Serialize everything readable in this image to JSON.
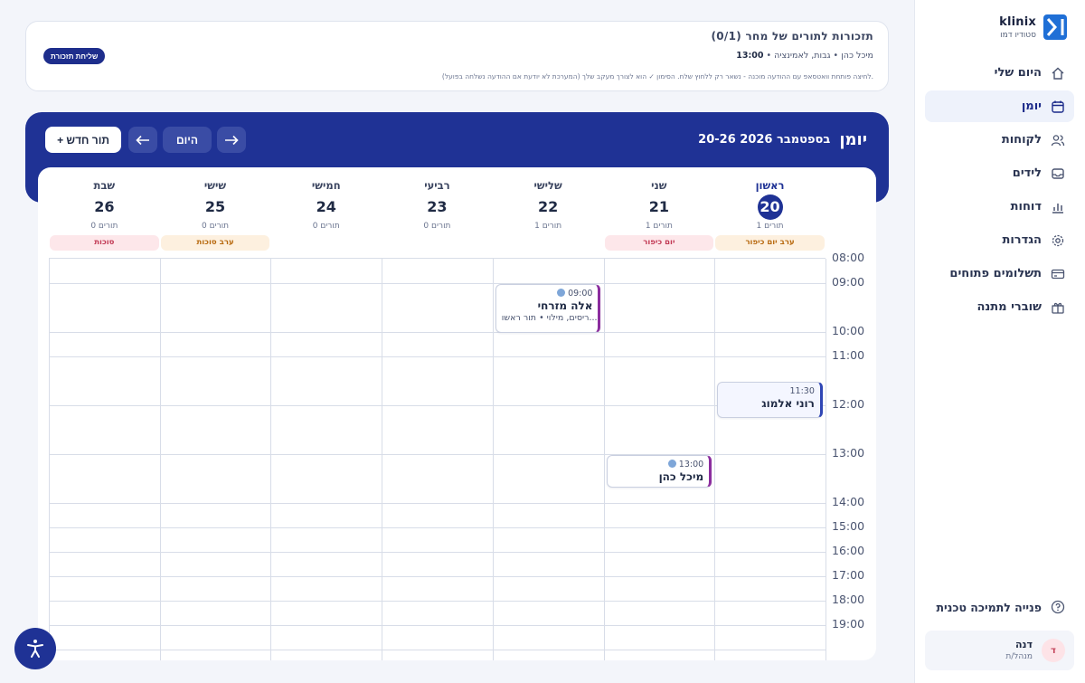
{
  "brand": {
    "name": "klinix",
    "subtitle": "סטודיו דמו"
  },
  "sidebar": {
    "items": [
      {
        "label": "היום שלי",
        "icon": "home-icon",
        "active": false
      },
      {
        "label": "יומן",
        "icon": "calendar-icon",
        "active": true
      },
      {
        "label": "לקוחות",
        "icon": "users-icon",
        "active": false
      },
      {
        "label": "לידים",
        "icon": "inbox-icon",
        "active": false
      },
      {
        "label": "דוחות",
        "icon": "bar-chart-icon",
        "active": false
      },
      {
        "label": "הגדרות",
        "icon": "gear-icon",
        "active": false
      },
      {
        "label": "תשלומים פתוחים",
        "icon": "credit-card-icon",
        "active": false
      },
      {
        "label": "שוברי מתנה",
        "icon": "gift-icon",
        "active": false
      }
    ],
    "support_label": "פנייה לתמיכה טכנית",
    "user": {
      "initial": "ד",
      "name": "דנה",
      "role": "מנהל/ת"
    }
  },
  "reminder": {
    "title": "תזכורות לתורים של מחר (0/1)",
    "time": "13:00",
    "details": " • מיכל כהן • גבות, לאמינציה",
    "note": "לחיצה פותחת וואטסאפ עם ההודעה מוכנה - נשאר רק ללחוץ שלח. הסימון ✓ הוא לצורך מעקב שלך (המערכת לא יודעת אם ההודעה נשלחה בפועל).",
    "button": "שליחת תזכורת"
  },
  "calendar": {
    "title": "יומן",
    "range": "20-26 בספטמבר 2026",
    "new_button": "+ תור חדש",
    "today_button": "היום",
    "prev_icon": "arrow-left-icon",
    "next_icon": "arrow-right-icon",
    "days": [
      {
        "name": "ראשון",
        "num": "20",
        "count": "1 תורים",
        "today": true
      },
      {
        "name": "שני",
        "num": "21",
        "count": "1 תורים",
        "today": false
      },
      {
        "name": "שלישי",
        "num": "22",
        "count": "1 תורים",
        "today": false
      },
      {
        "name": "רביעי",
        "num": "23",
        "count": "0 תורים",
        "today": false
      },
      {
        "name": "חמישי",
        "num": "24",
        "count": "0 תורים",
        "today": false
      },
      {
        "name": "שישי",
        "num": "25",
        "count": "0 תורים",
        "today": false
      },
      {
        "name": "שבת",
        "num": "26",
        "count": "0 תורים",
        "today": false
      }
    ],
    "holidays": [
      {
        "day": 0,
        "label": "ערב יום כיפור",
        "color": "amber"
      },
      {
        "day": 1,
        "label": "יום כיפור",
        "color": "red"
      },
      {
        "day": 5,
        "label": "ערב סוכות",
        "color": "amber"
      },
      {
        "day": 6,
        "label": "סוכות",
        "color": "red"
      }
    ],
    "hours": [
      "08:00",
      "09:00",
      "10:00",
      "11:00",
      "12:00",
      "13:00",
      "14:00",
      "15:00",
      "16:00",
      "17:00",
      "18:00",
      "19:00"
    ],
    "appointments": [
      {
        "day": 2,
        "time": "09:00",
        "name": "אלה מזרחי",
        "desc": "ריסים, מילוי • תור ראשו...",
        "style": "purple",
        "has_dot": true
      },
      {
        "day": 0,
        "time": "11:30",
        "name": "רוני אלמוג",
        "desc": "",
        "style": "blue",
        "has_dot": false
      },
      {
        "day": 1,
        "time": "13:00",
        "name": "מיכל כהן",
        "desc": "",
        "style": "purple",
        "has_dot": true
      }
    ]
  },
  "accessibility_icon": "accessibility-icon"
}
